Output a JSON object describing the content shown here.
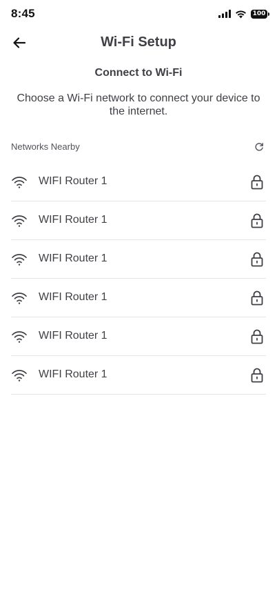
{
  "status_bar": {
    "time": "8:45",
    "battery": "100",
    "icons": [
      "signal-icon",
      "wifi-status-icon",
      "battery-icon"
    ]
  },
  "header": {
    "title": "Wi-Fi Setup",
    "back_icon": "arrow-left-icon"
  },
  "main": {
    "subtitle": "Connect to Wi-Fi",
    "description": "Choose a Wi-Fi network to connect your device to the internet.",
    "section_label": "Networks Nearby",
    "refresh_icon": "refresh-icon",
    "networks": [
      {
        "name": "WIFI Router 1",
        "icon": "wifi-icon",
        "secured_icon": "lock-icon"
      },
      {
        "name": "WIFI Router 1",
        "icon": "wifi-icon",
        "secured_icon": "lock-icon"
      },
      {
        "name": "WIFI Router 1",
        "icon": "wifi-icon",
        "secured_icon": "lock-icon"
      },
      {
        "name": "WIFI Router 1",
        "icon": "wifi-icon",
        "secured_icon": "lock-icon"
      },
      {
        "name": "WIFI Router 1",
        "icon": "wifi-icon",
        "secured_icon": "lock-icon"
      },
      {
        "name": "WIFI Router 1",
        "icon": "wifi-icon",
        "secured_icon": "lock-icon"
      }
    ]
  },
  "colors": {
    "text": "#3f3f46",
    "divider": "#e4e4e7",
    "background": "#ffffff"
  }
}
